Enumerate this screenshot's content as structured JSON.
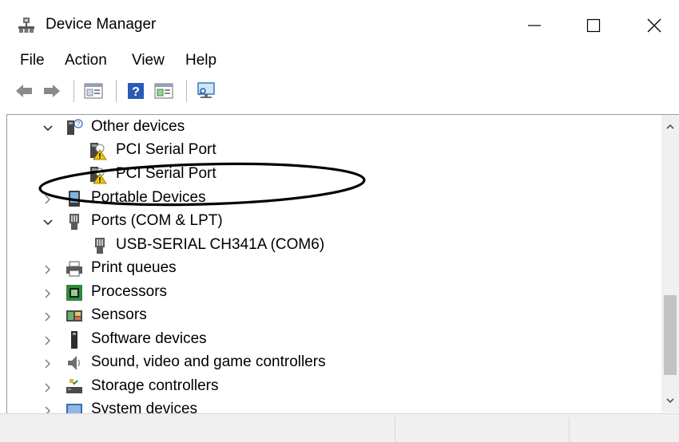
{
  "window": {
    "title": "Device Manager",
    "controls": {
      "minimize": "—",
      "maximize": "☐",
      "close": "✕"
    }
  },
  "menu": [
    {
      "label": "File"
    },
    {
      "label": "Action"
    },
    {
      "label": "View"
    },
    {
      "label": "Help"
    }
  ],
  "toolbar": {
    "buttons": [
      "back-arrow-icon",
      "forward-arrow-icon",
      "properties-icon",
      "help-icon",
      "update-driver-icon",
      "scan-hardware-icon"
    ]
  },
  "tree": {
    "rows": [
      {
        "label": "Other devices",
        "expanded": true,
        "level": 0,
        "icon": "unknown-device-icon"
      },
      {
        "label": "PCI Serial Port",
        "level": 1,
        "icon": "warning-device-icon"
      },
      {
        "label": "PCI Serial Port",
        "level": 1,
        "icon": "warning-device-icon"
      },
      {
        "label": "Portable Devices",
        "expanded": false,
        "level": 0,
        "icon": "portable-device-icon"
      },
      {
        "label": "Ports (COM & LPT)",
        "expanded": true,
        "level": 0,
        "icon": "port-icon"
      },
      {
        "label": "USB-SERIAL CH341A (COM6)",
        "level": 1,
        "icon": "port-icon"
      },
      {
        "label": "Print queues",
        "expanded": false,
        "level": 0,
        "icon": "printer-icon"
      },
      {
        "label": "Processors",
        "expanded": false,
        "level": 0,
        "icon": "processor-icon"
      },
      {
        "label": "Sensors",
        "expanded": false,
        "level": 0,
        "icon": "sensor-icon"
      },
      {
        "label": "Software devices",
        "expanded": false,
        "level": 0,
        "icon": "software-device-icon"
      },
      {
        "label": "Sound, video and game controllers",
        "expanded": false,
        "level": 0,
        "icon": "speaker-icon"
      },
      {
        "label": "Storage controllers",
        "expanded": false,
        "level": 0,
        "icon": "storage-icon"
      },
      {
        "label": "System devices",
        "expanded": false,
        "level": 0,
        "icon": "system-device-icon"
      }
    ]
  },
  "colors": {
    "warning": "#f2c200",
    "annotation": "#000000",
    "processor_green": "#2f8a3a",
    "port_gray": "#5a5a5a"
  }
}
